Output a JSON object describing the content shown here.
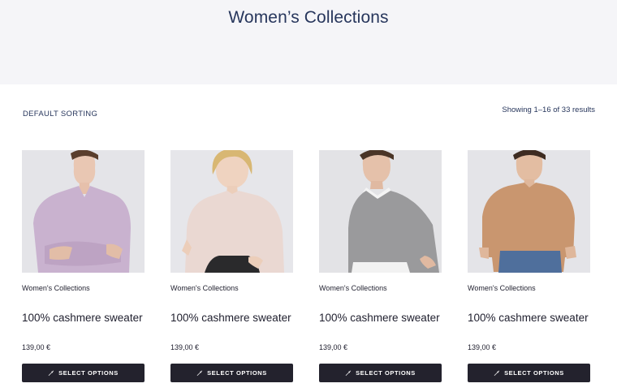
{
  "page": {
    "title": "Women’s Collections"
  },
  "toolbar": {
    "sorting_label": "DEFAULT SORTING",
    "results_text": "Showing 1–16 of 33 results"
  },
  "colors": {
    "title": "#27365c",
    "button_bg": "#23222d",
    "hero_bg": "#f5f5f8"
  },
  "products": [
    {
      "category": "Women's Collections",
      "name": "100% cashmere sweater",
      "price": "139,00 €",
      "button_label": "SELECT OPTIONS",
      "button_icon": "wrench-icon",
      "image": "woman in lilac cashmere sweater, arms crossed",
      "sweater_color": "#c9b2cf"
    },
    {
      "category": "Women's Collections",
      "name": "100% cashmere sweater",
      "price": "139,00 €",
      "button_label": "SELECT OPTIONS",
      "button_icon": "wrench-icon",
      "image": "blonde woman in light pink cashmere sweater",
      "sweater_color": "#ead8d2"
    },
    {
      "category": "Women's Collections",
      "name": "100% cashmere sweater",
      "price": "139,00 €",
      "button_label": "SELECT OPTIONS",
      "button_icon": "wrench-icon",
      "image": "woman in grey cashmere sweater with white collar",
      "sweater_color": "#9a9a9c"
    },
    {
      "category": "Women's Collections",
      "name": "100% cashmere sweater",
      "price": "139,00 €",
      "button_label": "SELECT OPTIONS",
      "button_icon": "wrench-icon",
      "image": "woman in camel cashmere sweater and jeans",
      "sweater_color": "#c9966f"
    }
  ]
}
